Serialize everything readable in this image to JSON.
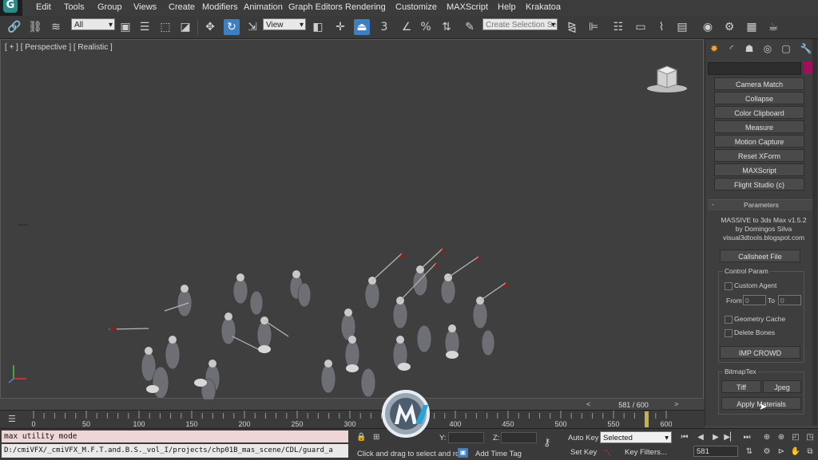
{
  "app": {
    "logo_glyph": "G"
  },
  "menu": [
    "Edit",
    "Tools",
    "Group",
    "Views",
    "Create",
    "Modifiers",
    "Animation",
    "Graph Editors",
    "Rendering",
    "Customize",
    "MAXScript",
    "Help",
    "Krakatoa"
  ],
  "toolbar": {
    "selection_filter": "All",
    "ref_coord": "View",
    "named_selection_placeholder": "Create Selection Se",
    "snap_label": "3",
    "percent_snap": "%"
  },
  "viewport": {
    "label": "[ + ] [ Perspective ] [ Realistic ]"
  },
  "panel": {
    "utility_buttons": [
      "Camera Match",
      "Collapse",
      "Color Clipboard",
      "Measure",
      "Motion Capture",
      "Reset XForm",
      "MAXScript",
      "Flight Studio (c)"
    ],
    "params_title": "Parameters",
    "params_minus": "-",
    "plugin_title": "MASSIVE to 3ds Max v1.5.2",
    "plugin_author": "by Domingos Silva",
    "plugin_site": "visual3dtools.blogspot.com",
    "callsheet_btn": "Callsheet File",
    "control_group": "Control Param",
    "custom_agent": "Custom Agent",
    "from_label": "From",
    "to_label": "To",
    "from_value": "0",
    "to_value": "0",
    "geometry_cache": "Geometry Cache",
    "delete_bones": "Delete Bones",
    "imp_crowd": "IMP CROWD",
    "bitmap_group": "BitmapTex",
    "tiff_btn": "Tiff",
    "jpeg_btn": "Jpeg",
    "apply_materials": "Apply Materials",
    "accent": "#a0105a"
  },
  "timeline": {
    "frame_display": "581 / 600",
    "ticks": [
      "0",
      "50",
      "100",
      "150",
      "200",
      "250",
      "300",
      "350",
      "400",
      "450",
      "500",
      "550",
      "600"
    ],
    "current_frame": 581,
    "total_frames": 600
  },
  "status": {
    "maxscript": "max utility mode",
    "path": "D:/cmiVFX/_cmiVFX_M.F.T.and.B.S._vol_I/projects/chp01B_mas_scene/CDL/guard_a",
    "prompt": "Click and drag to select and rot",
    "add_time_tag": "Add Time Tag",
    "y_label": "Y:",
    "z_label": "Z:",
    "auto_key": "Auto Key",
    "set_key": "Set Key",
    "selected": "Selected",
    "key_filters": "Key Filters...",
    "frame": "581"
  }
}
